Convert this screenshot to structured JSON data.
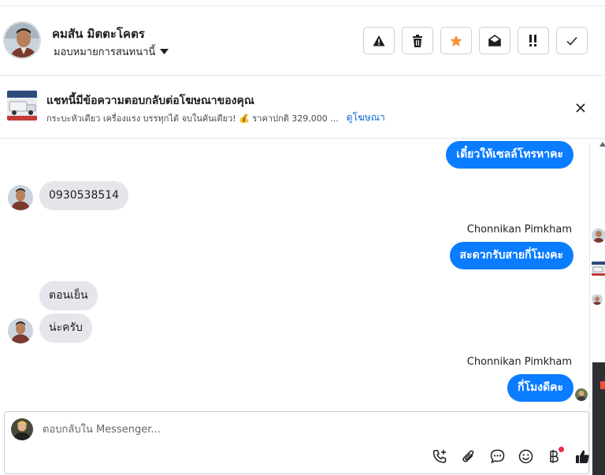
{
  "header": {
    "contact_name": "คมสัน มิตตะโคตร",
    "assign_label": "มอบหมายการสนทนานี้",
    "actions": [
      "spam-icon",
      "trash-icon",
      "star-icon",
      "envelope-open-icon",
      "priority-icon",
      "check-icon"
    ],
    "star_color": "#f7923b"
  },
  "ad": {
    "title": "แชทนี้มีข้อความตอบกลับต่อโฆษณาของคุณ",
    "description": "กระบะหัวเดียว เครื่องแรง บรรทุกได้ จบในคันเดียว! 💰 ราคาปกติ 329,000 ...",
    "link_label": "ดูโฆษณา"
  },
  "messages": [
    {
      "direction": "out",
      "text": "เดี๋ยวให้เซลล์โทรหาคะ"
    },
    {
      "direction": "in",
      "text": "0930538514"
    },
    {
      "direction": "out",
      "sender": "Chonnikan Pimkham",
      "text": "สะดวกรับสายกี่โมงคะ"
    },
    {
      "direction": "in",
      "text": "ตอนเย็น"
    },
    {
      "direction": "in",
      "text": "น่ะครับ"
    },
    {
      "direction": "out",
      "sender": "Chonnikan Pimkham",
      "text": "กี่โมงดีคะ"
    }
  ],
  "composer": {
    "placeholder": "ตอบกลับใน Messenger...",
    "tools": [
      "add-call-icon",
      "attachment-icon",
      "saved-reply-icon",
      "emoji-icon",
      "payment-icon",
      "like-icon"
    ]
  },
  "colors": {
    "accent": "#0a7cff",
    "incoming_bubble": "#e4e6eb",
    "link": "#0b63d6",
    "notification": "#f02849"
  }
}
